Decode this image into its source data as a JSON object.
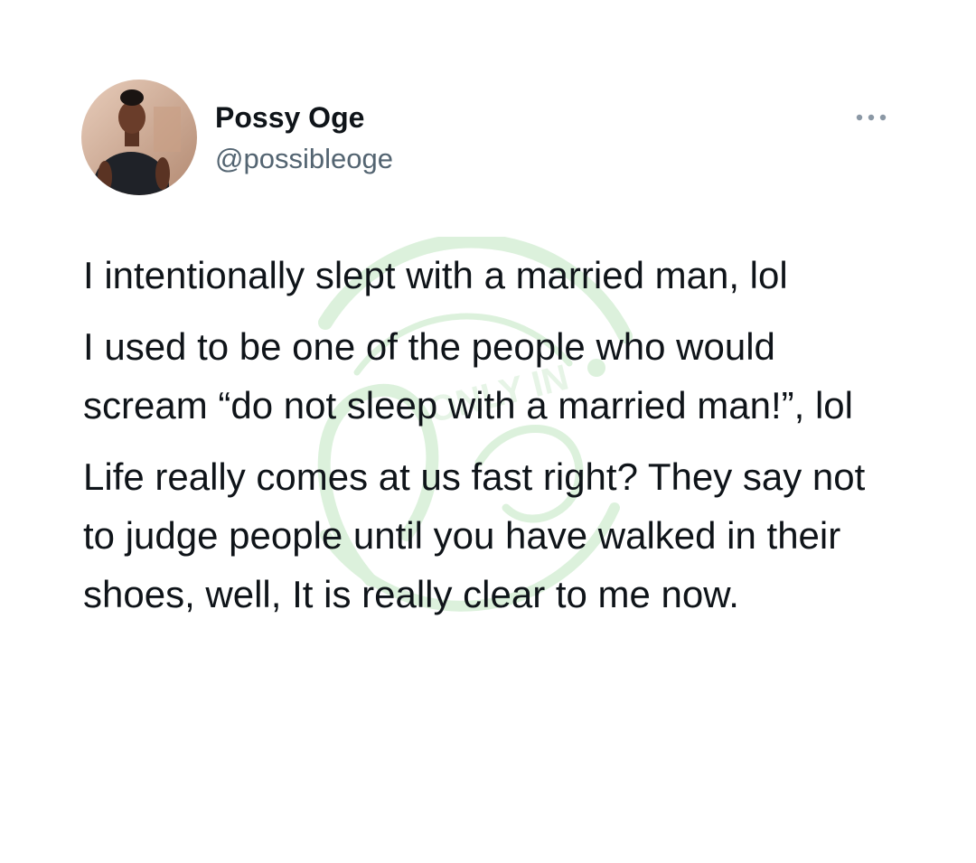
{
  "tweet": {
    "author": {
      "display_name": "Possy Oge",
      "handle": "@possibleoge"
    },
    "more_icon": "more-horizontal-icon",
    "paragraphs": [
      "I intentionally slept with a married man, lol",
      "I used to be one of the people who would scream “do not sleep with a married man!”, lol",
      "Life really comes at us fast right? They say not to judge people until you have walked in their shoes, well, It is really clear to me now."
    ]
  },
  "watermark": {
    "text": "ONLY IN",
    "script": "Naija",
    "color": "#8fd18f"
  },
  "colors": {
    "text": "#0f1419",
    "secondary": "#536471",
    "background": "#ffffff"
  }
}
